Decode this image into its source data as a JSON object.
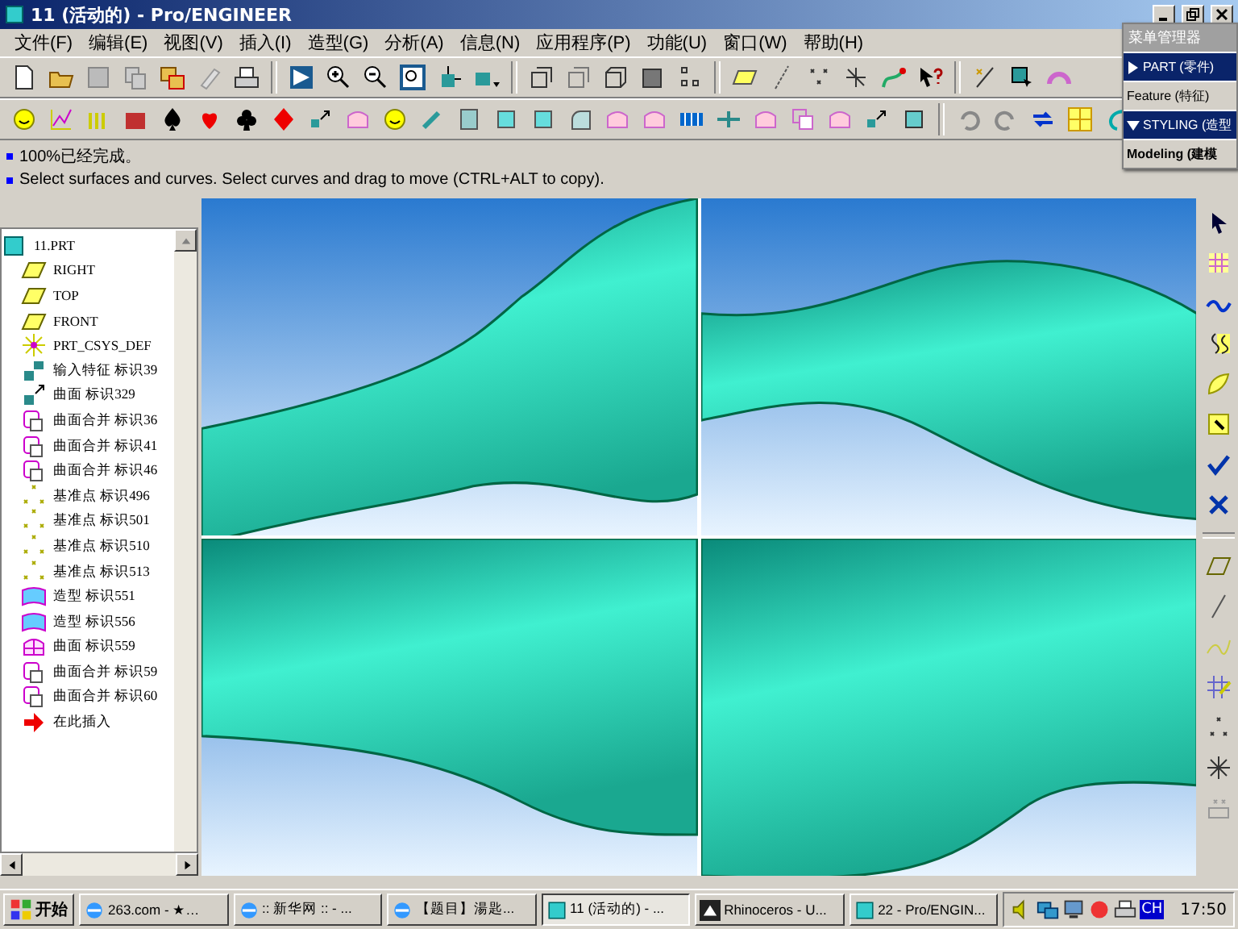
{
  "window": {
    "title": "11 (活动的) - Pro/ENGINEER"
  },
  "menu": [
    "文件(F)",
    "编辑(E)",
    "视图(V)",
    "插入(I)",
    "造型(G)",
    "分析(A)",
    "信息(N)",
    "应用程序(P)",
    "功能(U)",
    "窗口(W)",
    "帮助(H)"
  ],
  "messages": [
    "100%已经完成。",
    "Select surfaces and curves.  Select curves and drag to move (CTRL+ALT to copy)."
  ],
  "menu_manager": {
    "title": "菜单管理器",
    "items": [
      {
        "label": "PART (零件)",
        "kind": "header",
        "expanded": false
      },
      {
        "label": "Feature (特征)",
        "kind": "plain"
      },
      {
        "label": "STYLING (造型",
        "kind": "header",
        "expanded": true
      },
      {
        "label": "Modeling (建模",
        "kind": "bold"
      }
    ]
  },
  "model_tree": {
    "label": "11.PRT",
    "kind": "part",
    "children": [
      {
        "label": "RIGHT",
        "kind": "plane"
      },
      {
        "label": "TOP",
        "kind": "plane"
      },
      {
        "label": "FRONT",
        "kind": "plane"
      },
      {
        "label": "PRT_CSYS_DEF",
        "kind": "csys"
      },
      {
        "label": "输入特征 标识39",
        "kind": "import"
      },
      {
        "label": "曲面 标识329",
        "kind": "surface"
      },
      {
        "label": "曲面合并 标识36",
        "kind": "merge"
      },
      {
        "label": "曲面合并 标识41",
        "kind": "merge"
      },
      {
        "label": "曲面合并 标识46",
        "kind": "merge"
      },
      {
        "label": "基准点 标识496",
        "kind": "point"
      },
      {
        "label": "基准点 标识501",
        "kind": "point"
      },
      {
        "label": "基准点 标识510",
        "kind": "point"
      },
      {
        "label": "基准点 标识513",
        "kind": "point"
      },
      {
        "label": "造型 标识551",
        "kind": "style"
      },
      {
        "label": "造型 标识556",
        "kind": "style"
      },
      {
        "label": "曲面 标识559",
        "kind": "surface2"
      },
      {
        "label": "曲面合并 标识59",
        "kind": "merge"
      },
      {
        "label": "曲面合并 标识60",
        "kind": "merge"
      },
      {
        "label": "在此插入",
        "kind": "insert"
      }
    ]
  },
  "taskbar": {
    "start": "开始",
    "tasks": [
      {
        "label": "263.com - ★…",
        "kind": "browser",
        "selected": false
      },
      {
        "label": ":: 新华网 :: - ...",
        "kind": "browser",
        "selected": false
      },
      {
        "label": "【题目】湯匙...",
        "kind": "browser",
        "selected": false
      },
      {
        "label": "11 (活动的) - ...",
        "kind": "proe",
        "selected": true
      },
      {
        "label": "Rhinoceros - U...",
        "kind": "rhino",
        "selected": false
      },
      {
        "label": "22 - Pro/ENGIN...",
        "kind": "proe",
        "selected": false
      }
    ],
    "tray_language": "CH",
    "clock": "17:50"
  }
}
